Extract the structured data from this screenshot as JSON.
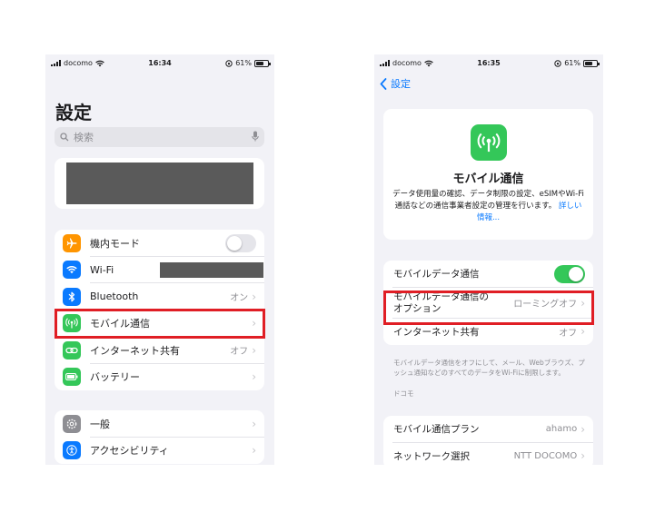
{
  "left_screen": {
    "status": {
      "carrier": "docomo",
      "time": "16:34",
      "battery": "61%"
    },
    "title": "設定",
    "search": {
      "placeholder": "検索"
    },
    "group1": [
      {
        "icon": "airplane-icon",
        "color": "#ff9500",
        "label": "機内モード",
        "control": "toggle",
        "state": "off"
      },
      {
        "icon": "wifi-icon",
        "color": "#0a7aff",
        "label": "Wi-Fi",
        "value": ""
      },
      {
        "icon": "bluetooth-icon",
        "color": "#0a7aff",
        "label": "Bluetooth",
        "value": "オン"
      },
      {
        "icon": "antenna-icon",
        "color": "#34c759",
        "label": "モバイル通信",
        "value": ""
      },
      {
        "icon": "hotspot-icon",
        "color": "#34c759",
        "label": "インターネット共有",
        "value": "オフ"
      },
      {
        "icon": "battery-icon",
        "color": "#34c759",
        "label": "バッテリー",
        "value": ""
      }
    ],
    "group2": [
      {
        "icon": "gear-icon",
        "color": "#8e8e93",
        "label": "一般"
      },
      {
        "icon": "accessibility-icon",
        "color": "#0a7aff",
        "label": "アクセシビリティ"
      }
    ]
  },
  "right_screen": {
    "status": {
      "carrier": "docomo",
      "time": "16:35",
      "battery": "61%"
    },
    "back_label": "設定",
    "header": {
      "title": "モバイル通信",
      "description": "データ使用量の確認、データ制限の設定、eSIMやWi-Fi通話などの通信事業者設定の管理を行います。",
      "link": "詳しい情報..."
    },
    "group1": [
      {
        "label": "モバイルデータ通信",
        "control": "toggle",
        "state": "on"
      },
      {
        "label": "モバイルデータ通信の\nオプション",
        "value": "ローミングオフ"
      },
      {
        "label": "インターネット共有",
        "value": "オフ"
      }
    ],
    "footnote": "モバイルデータ通信をオフにして、メール、Webブラウズ、プッシュ通知などのすべてのデータをWi-Fiに制限します。",
    "section_header": "ドコモ",
    "group2": [
      {
        "label": "モバイル通信プラン",
        "value": "ahamo"
      },
      {
        "label": "ネットワーク選択",
        "value": "NTT DOCOMO"
      }
    ]
  },
  "colors": {
    "highlight": "#e01e25",
    "toggle_on": "#34c759",
    "link": "#0a7aff"
  }
}
